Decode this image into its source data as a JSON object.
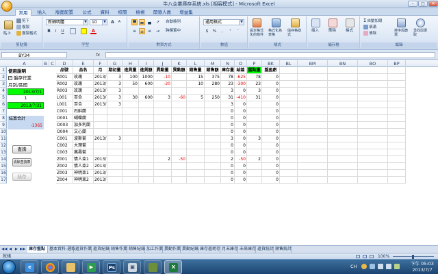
{
  "window": {
    "title": "牛八企業庫存系統.xls [相容模式] - Microsoft Excel",
    "minimize": "–",
    "maximize": "□",
    "close": "✕"
  },
  "ribbon_tabs": [
    "常用",
    "插入",
    "版面配置",
    "公式",
    "資料",
    "校閱",
    "檢視",
    "開發人員",
    "增益集"
  ],
  "ribbon": {
    "clipboard": {
      "paste": "貼上",
      "cut": "剪下",
      "copy": "複製",
      "format_painter": "複製格式",
      "label": "剪貼簿"
    },
    "font": {
      "font_name": "新細明體",
      "font_size": "10",
      "bold": "B",
      "italic": "I",
      "underline": "U",
      "grow": "A",
      "shrink": "A",
      "label": "字型"
    },
    "alignment": {
      "wrap": "自動換列",
      "merge": "跨欄置中",
      "label": "對齊方式"
    },
    "number": {
      "format": "通用格式",
      "currency": "$",
      "percent": "%",
      "comma": ",",
      "label": "數值"
    },
    "styles": {
      "conditional": "設定格式化的條件",
      "as_table": "格式化為表格",
      "cell_styles": "儲存格樣式",
      "label": "樣式"
    },
    "cells": {
      "insert": "插入",
      "delete": "刪除",
      "format": "格式",
      "label": "儲存格"
    },
    "editing": {
      "autosum": "自動加總",
      "fill": "填滿",
      "clear": "清除",
      "sort": "排序與篩選",
      "find": "尋找與選取",
      "label": "編輯"
    }
  },
  "formula_bar": {
    "name_box": "BY34",
    "fx": "fx",
    "formula": ""
  },
  "columns": [
    "A",
    "B",
    "C",
    "D",
    "E",
    "F",
    "G",
    "H",
    "I",
    "J",
    "K",
    "L",
    "M",
    "N",
    "O",
    "P",
    "BK",
    "BL",
    "BM",
    "BN",
    "BO",
    "BP"
  ],
  "rows": [
    "1",
    "2",
    "3",
    "4",
    "5",
    "6",
    "7",
    "8",
    "9",
    "10",
    "11",
    "12",
    "13",
    "14",
    "15",
    "16",
    "17"
  ],
  "side_panel": {
    "title": "使用說明",
    "checkbox_label": "盤存作業",
    "checked": "✓",
    "period_label": "月別/區間",
    "date_start": "2013/7/1",
    "date_mid": "1",
    "date_end": "2013/7/31",
    "settle_label": "結算合計",
    "settle_value": "-1365",
    "btn_query": "查詢",
    "btn_clear": "清除查詢表",
    "btn_save": "結存"
  },
  "table_header": [
    "品號",
    "品名",
    "月",
    "期初量",
    "進貨量",
    "進貨額",
    "異動量",
    "異動額",
    "銷售量",
    "銷售額",
    "庫存量",
    "結論",
    "盤點量",
    "盤盈虧"
  ],
  "table_rows": [
    {
      "code": "R001",
      "name": "玫瑰",
      "month": "2013/7/1",
      "begin": "3",
      "in_qty": "100",
      "in_amt": "1000",
      "adj_qty": "-10",
      "adj_amt": "",
      "sale_qty": "15",
      "sale_amt": "375",
      "stock": "78",
      "result": "-625",
      "count": "78",
      "diff": "0"
    },
    {
      "code": "R002",
      "name": "玫瑰",
      "month": "2013/7/1",
      "begin": "3",
      "in_qty": "50",
      "in_amt": "600",
      "adj_qty": "-20",
      "adj_amt": "",
      "sale_qty": "10",
      "sale_amt": "280",
      "stock": "23",
      "result": "-300",
      "count": "23",
      "diff": "0"
    },
    {
      "code": "R003",
      "name": "玫瑰",
      "month": "2013/7/1",
      "begin": "3",
      "in_qty": "",
      "in_amt": "",
      "adj_qty": "",
      "adj_amt": "",
      "sale_qty": "",
      "sale_amt": "",
      "stock": "3",
      "result": "0",
      "count": "3",
      "diff": "0"
    },
    {
      "code": "L001",
      "name": "百合",
      "month": "2013/7/1",
      "begin": "3",
      "in_qty": "30",
      "in_amt": "600",
      "adj_qty": "3",
      "adj_amt": "-60",
      "sale_qty": "5",
      "sale_amt": "250",
      "stock": "31",
      "result": "-410",
      "count": "31",
      "diff": "0"
    },
    {
      "code": "L001",
      "name": "百合",
      "month": "2013/7/1",
      "begin": "3",
      "in_qty": "",
      "in_amt": "",
      "adj_qty": "",
      "adj_amt": "",
      "sale_qty": "",
      "sale_amt": "",
      "stock": "3",
      "result": "0",
      "count": "",
      "diff": "0"
    },
    {
      "code": "C001",
      "name": "石斛蘭",
      "month": "",
      "begin": "",
      "in_qty": "",
      "in_amt": "",
      "adj_qty": "",
      "adj_amt": "",
      "sale_qty": "",
      "sale_amt": "",
      "stock": "0",
      "result": "0",
      "count": "",
      "diff": "0"
    },
    {
      "code": "O001",
      "name": "蝴蝶蘭",
      "month": "",
      "begin": "",
      "in_qty": "",
      "in_amt": "",
      "adj_qty": "",
      "adj_amt": "",
      "sale_qty": "",
      "sale_amt": "",
      "stock": "0",
      "result": "0",
      "count": "",
      "diff": "0"
    },
    {
      "code": "O003",
      "name": "加多利蘭",
      "month": "",
      "begin": "",
      "in_qty": "",
      "in_amt": "",
      "adj_qty": "",
      "adj_amt": "",
      "sale_qty": "",
      "sale_amt": "",
      "stock": "0",
      "result": "0",
      "count": "",
      "diff": "0"
    },
    {
      "code": "O004",
      "name": "文心蘭",
      "month": "",
      "begin": "",
      "in_qty": "",
      "in_amt": "",
      "adj_qty": "",
      "adj_amt": "",
      "sale_qty": "",
      "sale_amt": "",
      "stock": "0",
      "result": "0",
      "count": "",
      "diff": "0"
    },
    {
      "code": "C001",
      "name": "波斯菊",
      "month": "2013/7/1",
      "begin": "3",
      "in_qty": "",
      "in_amt": "",
      "adj_qty": "",
      "adj_amt": "",
      "sale_qty": "",
      "sale_amt": "",
      "stock": "3",
      "result": "0",
      "count": "3",
      "diff": "0"
    },
    {
      "code": "C002",
      "name": "大理菊",
      "month": "",
      "begin": "",
      "in_qty": "",
      "in_amt": "",
      "adj_qty": "",
      "adj_amt": "",
      "sale_qty": "",
      "sale_amt": "",
      "stock": "0",
      "result": "0",
      "count": "",
      "diff": "0"
    },
    {
      "code": "C003",
      "name": "萬壽菊",
      "month": "",
      "begin": "",
      "in_qty": "",
      "in_amt": "",
      "adj_qty": "",
      "adj_amt": "",
      "sale_qty": "",
      "sale_amt": "",
      "stock": "0",
      "result": "0",
      "count": "",
      "diff": "0"
    },
    {
      "code": "Z001",
      "name": "情人束1",
      "month": "2013/7/1",
      "begin": "",
      "in_qty": "",
      "in_amt": "",
      "adj_qty": "2",
      "adj_amt": "-50",
      "sale_qty": "",
      "sale_amt": "",
      "stock": "2",
      "result": "-50",
      "count": "2",
      "diff": "0"
    },
    {
      "code": "Z002",
      "name": "情人束2",
      "month": "2013/7/1",
      "begin": "",
      "in_qty": "",
      "in_amt": "",
      "adj_qty": "",
      "adj_amt": "",
      "sale_qty": "",
      "sale_amt": "",
      "stock": "0",
      "result": "0",
      "count": "",
      "diff": "0"
    },
    {
      "code": "Z003",
      "name": "神明束1",
      "month": "2013/7/1",
      "begin": "",
      "in_qty": "",
      "in_amt": "",
      "adj_qty": "",
      "adj_amt": "",
      "sale_qty": "",
      "sale_amt": "",
      "stock": "0",
      "result": "0",
      "count": "",
      "diff": "0"
    },
    {
      "code": "Z004",
      "name": "神明束2",
      "month": "2013/7/1",
      "begin": "",
      "in_qty": "",
      "in_amt": "",
      "adj_qty": "",
      "adj_amt": "",
      "sale_qty": "",
      "sale_amt": "",
      "stock": "0",
      "result": "0",
      "count": "",
      "diff": "0"
    }
  ],
  "sheet_tabs": [
    "庫存盤點",
    "基本資料-選取",
    "進貨作業",
    "進貨紀錄",
    "銷售作業",
    "銷售紀錄",
    "加工作業",
    "異動作業",
    "異動紀錄",
    "庫存進耗存",
    "月末庫存",
    "未來庫存",
    "進貨統計",
    "銷售統計"
  ],
  "status_text": "就緒",
  "zoom": "100%",
  "taskbar": {
    "lang": "CH",
    "time": "下午 05:03",
    "date": "2013/7/7"
  },
  "colors": {
    "green_fill": "#00ff00",
    "selected_blue": "#c6d9f1",
    "red_text": "#e00000"
  }
}
